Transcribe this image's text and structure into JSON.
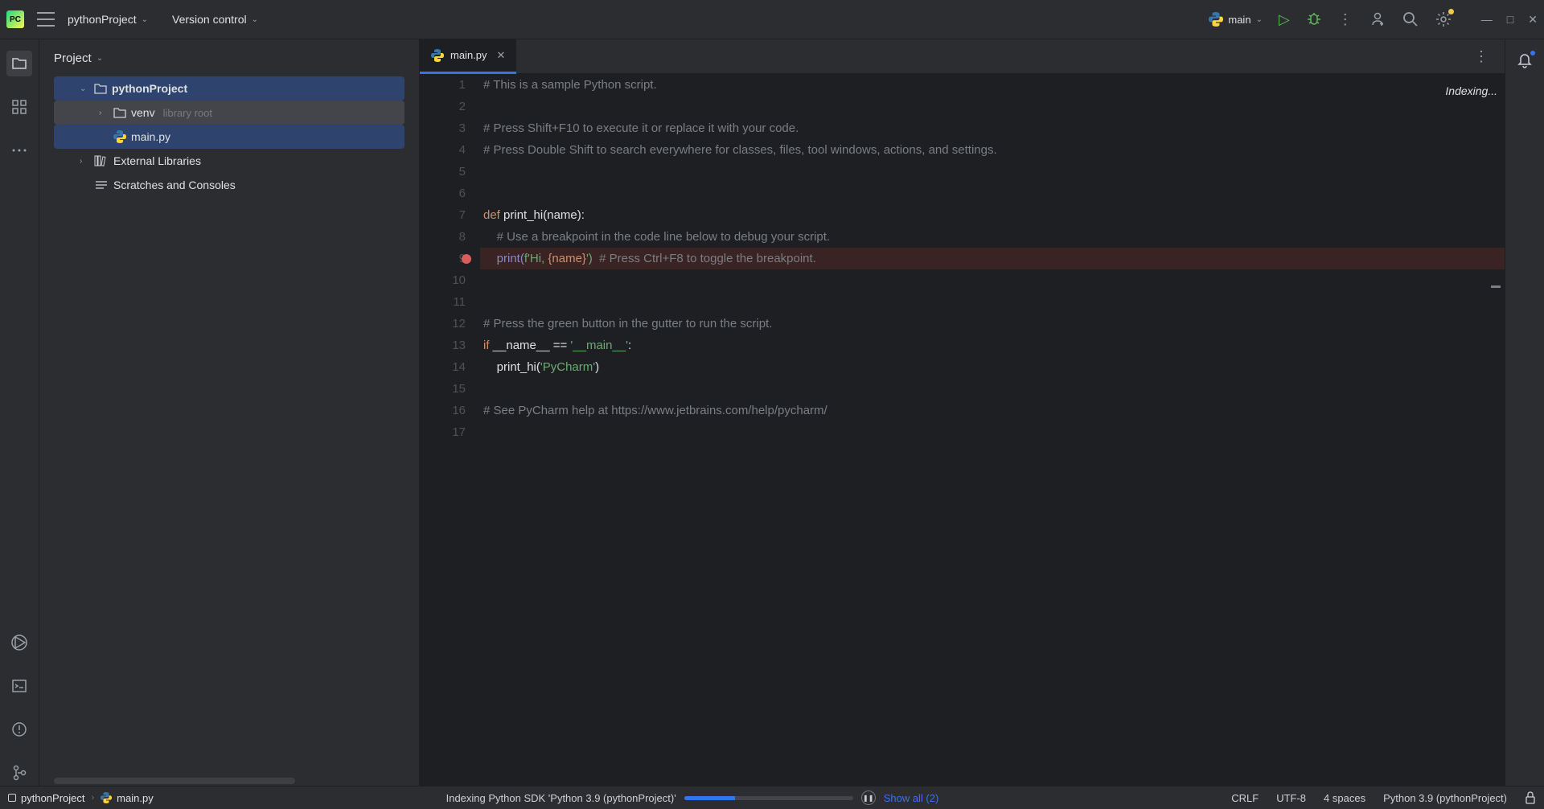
{
  "titlebar": {
    "project_name": "pythonProject",
    "version_control": "Version control",
    "run_config": "main"
  },
  "project_panel": {
    "title": "Project",
    "root": "pythonProject",
    "venv": "venv",
    "venv_note": "library root",
    "file": "main.py",
    "external_libraries": "External Libraries",
    "scratches": "Scratches and Consoles"
  },
  "editor": {
    "tab_name": "main.py",
    "indexing": "Indexing...",
    "lines": [
      1,
      2,
      3,
      4,
      5,
      6,
      7,
      8,
      9,
      10,
      11,
      12,
      13,
      14,
      15,
      16,
      17
    ],
    "breakpoint_line": 9,
    "code": {
      "l1": "# This is a sample Python script.",
      "l3": "# Press Shift+F10 to execute it or replace it with your code.",
      "l4": "# Press Double Shift to search everywhere for classes, files, tool windows, actions, and settings.",
      "l7_def": "def ",
      "l7_name": "print_hi(name):",
      "l8": "    # Use a breakpoint in the code line below to debug your script.",
      "l9_print": "    print(",
      "l9_f": "f'",
      "l9_hi": "Hi, ",
      "l9_brace": "{name}",
      "l9_end": "')",
      "l9_comment": "  # Press Ctrl+F8 to toggle the breakpoint.",
      "l12": "# Press the green button in the gutter to run the script.",
      "l13_if": "if ",
      "l13_name": "__name__ == ",
      "l13_main": "'__main__'",
      "l13_colon": ":",
      "l14_call": "    print_hi(",
      "l14_arg": "'PyCharm'",
      "l14_end": ")",
      "l16": "# See PyCharm help at https://www.jetbrains.com/help/pycharm/"
    }
  },
  "statusbar": {
    "project": "pythonProject",
    "file": "main.py",
    "indexing_msg": "Indexing Python SDK 'Python 3.9 (pythonProject)'",
    "show_all": "Show all (2)",
    "line_sep": "CRLF",
    "encoding": "UTF-8",
    "indent": "4 spaces",
    "interpreter": "Python 3.9 (pythonProject)"
  }
}
